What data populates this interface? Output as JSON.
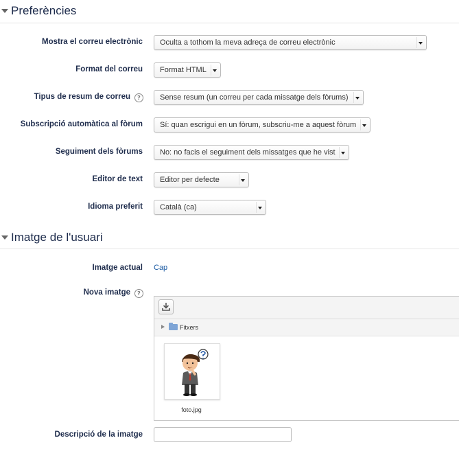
{
  "sections": {
    "preferences": "Preferències",
    "user_image": "Imatge de l'usuari"
  },
  "fields": {
    "maildisplay": {
      "label": "Mostra el correu electrònic",
      "value": "Oculta a tothom la meva adreça de correu electrònic"
    },
    "mailformat": {
      "label": "Format del correu",
      "value": "Format HTML"
    },
    "maildigest": {
      "label": "Tipus de resum de correu",
      "value": "Sense resum (un correu per cada missatge dels fòrums)",
      "help": "?"
    },
    "autosubscribe": {
      "label": "Subscripció automàtica al fòrum",
      "value": "Sí: quan escrigui en un fòrum, subscriu-me a aquest fòrum"
    },
    "trackforums": {
      "label": "Seguiment dels fòrums",
      "value": "No: no facis el seguiment dels missatges que he vist"
    },
    "editor": {
      "label": "Editor de text",
      "value": "Editor per defecte"
    },
    "lang": {
      "label": "Idioma preferit",
      "value": "Català (ca)"
    },
    "current_image": {
      "label": "Imatge actual",
      "value": "Cap"
    },
    "new_image": {
      "label": "Nova imatge",
      "help": "?"
    },
    "image_desc": {
      "label": "Descripció de la imatge",
      "value": ""
    }
  },
  "filepicker": {
    "folder": "Fitxers",
    "file": "foto.jpg",
    "icons": {
      "download": "download-icon",
      "folder": "folder-icon",
      "expand": "expand-triangle-icon"
    }
  },
  "colors": {
    "label": "#1f2d4d",
    "link": "#1a5aa3",
    "border": "#bbbbbb"
  }
}
